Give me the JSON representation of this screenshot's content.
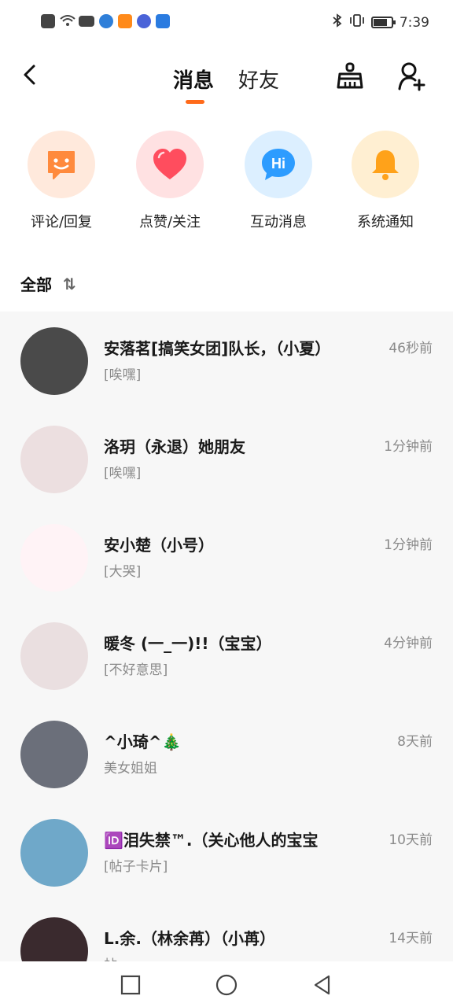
{
  "status_bar": {
    "time": "7:39",
    "left_icons": [
      "alert-icon",
      "wifi-icon",
      "camera-icon",
      "browser-icon",
      "video-app-icon",
      "music-icon",
      "notification-icon"
    ],
    "right_icons": [
      "bluetooth-icon",
      "vibrate-icon",
      "battery-icon"
    ],
    "battery_level": 0.7
  },
  "header": {
    "tabs": [
      {
        "label": "消息",
        "active": true
      },
      {
        "label": "好友",
        "active": false
      }
    ],
    "accent": "#ff6a1a"
  },
  "quick_actions": [
    {
      "label": "评论/回复",
      "icon": "comment-icon",
      "bg": "#ffe9dc",
      "color": "#ff8a3d"
    },
    {
      "label": "点赞/关注",
      "icon": "heart-icon",
      "bg": "#ffe1e2",
      "color": "#ff4d5e"
    },
    {
      "label": "互动消息",
      "icon": "hi-bubble-icon",
      "bg": "#dcefff",
      "color": "#2d9cff",
      "icon_text": "Hi"
    },
    {
      "label": "系统通知",
      "icon": "bell-icon",
      "bg": "#ffefd2",
      "color": "#ffa21a"
    }
  ],
  "section": {
    "title": "全部",
    "sort_icon_text": "⇅"
  },
  "conversations": [
    {
      "name": "安落茗[搞笑女团]队长，（小夏）",
      "message": "[唉嘿]",
      "time": "46秒前",
      "avatar_color": "#4a4a4a"
    },
    {
      "name": "洛玥（永退）她朋友",
      "message": "[唉嘿]",
      "time": "1分钟前",
      "avatar_color": "#ecdfe0"
    },
    {
      "name": "安小楚（小号）",
      "message": "[大哭]",
      "time": "1分钟前",
      "avatar_color": "#fff3f6"
    },
    {
      "name": "暖冬 (一_一)!!（宝宝）",
      "message": "[不好意思]",
      "time": "4分钟前",
      "avatar_color": "#eadfe0"
    },
    {
      "name": "^小琦^🎄",
      "message": "美女姐姐",
      "time": "8天前",
      "avatar_color": "#6b6f7a"
    },
    {
      "name": "🆔泪失禁™.（关心他人的宝宝",
      "message": "[帖子卡片]",
      "time": "10天前",
      "avatar_color": "#6fa8c9"
    },
    {
      "name": "L.余.（林余苒）（小苒）",
      "message": "帖",
      "time": "14天前",
      "avatar_color": "#3a2a2e"
    }
  ]
}
